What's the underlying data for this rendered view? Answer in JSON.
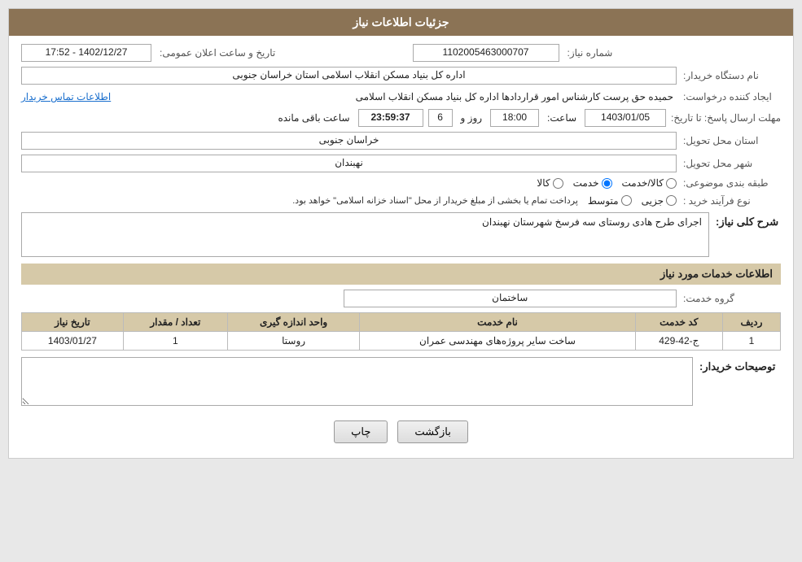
{
  "header": {
    "title": "جزئیات اطلاعات نیاز"
  },
  "fields": {
    "shomara_niaz_label": "شماره نیاز:",
    "shomara_niaz_value": "1102005463000707",
    "nam_dastgah_label": "نام دستگاه خریدار:",
    "nam_dastgah_value": "اداره کل بنیاد مسکن انقلاب اسلامی استان خراسان جنوبی",
    "ijad_konande_label": "ایجاد کننده درخواست:",
    "ijad_konande_value": "حمیده حق پرست کارشناس امور قراردادها اداره کل بنیاد مسکن انقلاب اسلامی",
    "ijad_konande_link": "اطلاعات تماس خریدار",
    "mohlat_label": "مهلت ارسال پاسخ: تا تاریخ:",
    "tarikh_value": "1403/01/05",
    "saat_label": "ساعت:",
    "saat_value": "18:00",
    "rooz_label": "روز و",
    "rooz_value": "6",
    "baqi_mande_label": "ساعت باقی مانده",
    "baqi_mande_value": "23:59:37",
    "tarikh_aalan_label": "تاریخ و ساعت اعلان عمومی:",
    "tarikh_aalan_value": "1402/12/27 - 17:52",
    "ostan_tahvil_label": "استان محل تحویل:",
    "ostan_tahvil_value": "خراسان جنوبی",
    "shahr_tahvil_label": "شهر محل تحویل:",
    "shahr_tahvil_value": "نهبندان",
    "tabaqe_label": "طبقه بندی موضوعی:",
    "radio_kala": "کالا",
    "radio_khadamat": "خدمت",
    "radio_kala_khadamat": "کالا/خدمت",
    "radio_kala_selected": false,
    "radio_khadamat_selected": true,
    "radio_kala_khadamat_selected": false,
    "nooe_farayand_label": "نوع فرآیند خرید :",
    "radio_jozvi": "جزیی",
    "radio_motavaset": "متوسط",
    "radio_pardakht": "پرداخت تمام یا بخشی از مبلغ خریدار از محل \"اسناد خزانه اسلامی\" خواهد بود.",
    "sharh_koli_label": "شرح کلی نیاز:",
    "sharh_koli_value": "اجرای طرح هادی روستای سه فرسخ شهرستان نهبندان",
    "section2_title": "اطلاعات خدمات مورد نیاز",
    "gorooh_khadamat_label": "گروه خدمت:",
    "gorooh_khadamat_value": "ساختمان",
    "table": {
      "headers": [
        "ردیف",
        "کد خدمت",
        "نام خدمت",
        "واحد اندازه گیری",
        "تعداد / مقدار",
        "تاریخ نیاز"
      ],
      "rows": [
        {
          "radif": "1",
          "code": "ج-42-429",
          "name": "ساخت سایر پروژه‌های مهندسی عمران",
          "unit": "روستا",
          "count": "1",
          "date": "1403/01/27"
        }
      ]
    },
    "toseeh_kharidar_label": "توصیحات خریدار:",
    "toseeh_kharidar_value": "",
    "btn_print": "چاپ",
    "btn_back": "بازگشت"
  }
}
